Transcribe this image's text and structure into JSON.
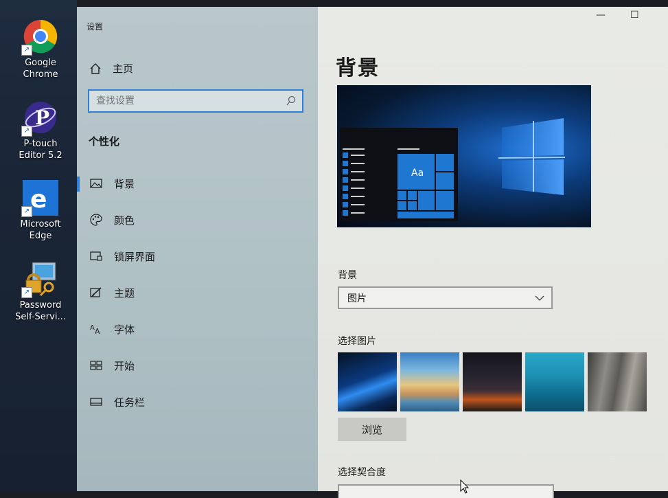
{
  "desktop": {
    "icons": [
      {
        "label": "Google\nChrome",
        "name": "chrome"
      },
      {
        "label": "P-touch\nEditor 5.2",
        "name": "ptouch"
      },
      {
        "label": "Microsoft\nEdge",
        "name": "edge"
      },
      {
        "label": "Password\nSelf-Servi...",
        "name": "password"
      }
    ]
  },
  "window": {
    "title": "设置",
    "controls": {
      "minimize": "—",
      "maximize": "☐"
    }
  },
  "sidebar": {
    "home_label": "主页",
    "search_placeholder": "查找设置",
    "section_title": "个性化",
    "items": [
      {
        "label": "背景",
        "icon": "picture-icon",
        "active": true
      },
      {
        "label": "颜色",
        "icon": "palette-icon",
        "active": false
      },
      {
        "label": "锁屏界面",
        "icon": "lock-screen-icon",
        "active": false
      },
      {
        "label": "主题",
        "icon": "theme-brush-icon",
        "active": false
      },
      {
        "label": "字体",
        "icon": "font-icon",
        "active": false
      },
      {
        "label": "开始",
        "icon": "start-tiles-icon",
        "active": false
      },
      {
        "label": "任务栏",
        "icon": "taskbar-icon",
        "active": false
      }
    ]
  },
  "main": {
    "title": "背景",
    "preview_tile_text": "Aa",
    "background_label": "背景",
    "background_value": "图片",
    "choose_picture_label": "选择图片",
    "browse_label": "浏览",
    "fit_label": "选择契合度"
  },
  "colors": {
    "accent": "#2f7fd6"
  }
}
